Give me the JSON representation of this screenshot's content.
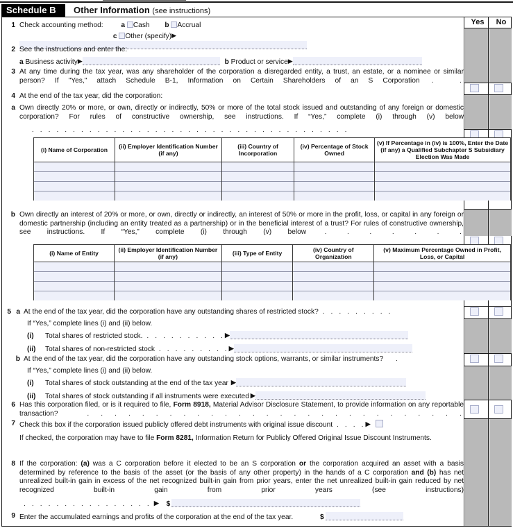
{
  "schedule": {
    "tag": "Schedule B",
    "title": "Other Information",
    "subtitle": "(see instructions)"
  },
  "yesno": {
    "yes": "Yes",
    "no": "No"
  },
  "lines": {
    "l1": {
      "num": "1",
      "label": "Check accounting method:",
      "a_letter": "a",
      "a_label": "Cash",
      "b_letter": "b",
      "b_label": "Accrual",
      "c_letter": "c",
      "c_label": "Other (specify)",
      "arrow": "▶"
    },
    "l2": {
      "num": "2",
      "label": "See the instructions and enter the:",
      "a_letter": "a",
      "a_label": "Business activity",
      "b_letter": "b",
      "b_label": "Product or service",
      "arrow": "▶"
    },
    "l3": {
      "num": "3",
      "text": "At any time during the tax year, was any shareholder of the corporation a disregarded entity, a trust, an estate, or a nominee or similar person? If \"Yes,\" attach Schedule B-1, Information on Certain Shareholders of an S Corporation"
    },
    "l4": {
      "num": "4",
      "text": "At the end of the tax year, did the corporation:",
      "a_letter": "a",
      "a_text": "Own directly 20% or more, or own, directly or indirectly, 50% or more of the total stock issued and outstanding of any foreign or domestic corporation? For rules of constructive ownership, see instructions. If “Yes,” complete (i) through (v) below",
      "b_letter": "b",
      "b_text": "Own directly an interest of 20% or more, or own, directly or indirectly, an interest of 50% or more in the profit, loss, or capital in any foreign or domestic partnership (including an entity treated as a partnership) or in the beneficial interest of a trust? For rules of constructive ownership, see instructions. If “Yes,” complete (i) through (v) below"
    },
    "l5": {
      "num": "5",
      "a_letter": "a",
      "a_text": "At the end of the tax year, did the corporation have any outstanding shares of restricted stock?",
      "a_note": "If “Yes,” complete lines (i) and (ii) below.",
      "a_i_label": "(i)",
      "a_i_text": "Total shares of restricted stock.",
      "a_ii_label": "(ii)",
      "a_ii_text": "Total shares of non-restricted stock",
      "b_letter": "b",
      "b_text": "At the end of the tax year, did the corporation have any outstanding stock options, warrants, or similar instruments?",
      "b_note": "If “Yes,” complete lines (i) and (ii) below.",
      "b_i_label": "(i)",
      "b_i_text": "Total shares of stock outstanding at the end of the tax year",
      "b_ii_label": "(ii)",
      "b_ii_text": "Total shares of stock outstanding if all instruments were executed",
      "arrow": "▶"
    },
    "l6": {
      "num": "6",
      "t1": "Has this corporation filed, or is it required to file, ",
      "bold": "Form 8918,",
      "t2": " Material Advisor Disclosure Statement, to provide information on any reportable transaction?"
    },
    "l7": {
      "num": "7",
      "text": "Check this box if the corporation issued publicly offered debt instruments with original issue discount",
      "arrow": "▶",
      "note1": "If checked, the corporation may have to file ",
      "note_bold": "Form 8281,",
      "note2": " Information Return for Publicly Offered Original Issue Discount Instruments."
    },
    "l8": {
      "num": "8",
      "p1": "If the corporation: ",
      "b1": "(a)",
      "p2": " was a C corporation before it elected to be an S corporation ",
      "b2": "or",
      "p3": " the corporation acquired an asset with a basis determined by reference to the basis of the asset (or the basis of any other property) in the hands of a C corporation ",
      "b3": "and (b)",
      "p4": " has net unrealized built-in gain in excess of the net recognized built-in gain from prior years, enter the net unrealized built-in gain reduced by net recognized built-in gain from prior years (see instructions)",
      "arrow": "▶",
      "dollar": "$"
    },
    "l9": {
      "num": "9",
      "text": "Enter the accumulated earnings and profits of the corporation at the end of the tax year.",
      "dollar": "$"
    }
  },
  "table_a": {
    "headers": [
      "(i) Name of Corporation",
      "(ii) Employer Identification Number (if any)",
      "(iii) Country of Incorporation",
      "(iv) Percentage of Stock Owned",
      "(v) If Percentage in (iv) is 100%, Enter the Date (if any) a Qualified Subchapter S Subsidiary Election Was Made"
    ],
    "header_parts": [
      {
        "bold": "(i)",
        "rest": " Name of Corporation"
      },
      {
        "bold": "(ii)",
        "rest": " Employer Identification Number (if any)"
      },
      {
        "bold": "(iii)",
        "rest": " Country of Incorporation"
      },
      {
        "bold": "(iv)",
        "rest": " Percentage of Stock Owned"
      },
      {
        "bold": "(v)",
        "rest": " If Percentage in (iv) is 100%, Enter the Date (if any) a Qualified Subchapter S Subsidiary Election Was Made"
      }
    ],
    "rows": 4
  },
  "table_b": {
    "headers": [
      "(i) Name of Entity",
      "(ii) Employer Identification Number (if any)",
      "(iii) Type of Entity",
      "(iv) Country of Organization",
      "(v) Maximum Percentage Owned in Profit, Loss, or Capital"
    ],
    "header_parts": [
      {
        "bold": "(i)",
        "rest": " Name of Entity"
      },
      {
        "bold": "(ii)",
        "rest": " Employer Identification Number (if any)"
      },
      {
        "bold": "(iii)",
        "rest": " Type of Entity"
      },
      {
        "bold": "(iv)",
        "rest": " Country of Organization"
      },
      {
        "bold": "(v)",
        "rest": " Maximum Percentage Owned in Profit, Loss, or Capital"
      }
    ],
    "rows": 4
  },
  "colors": {
    "shade": "#b9b9b9",
    "field": "#eef0fa",
    "border": "#1a1a1a"
  }
}
